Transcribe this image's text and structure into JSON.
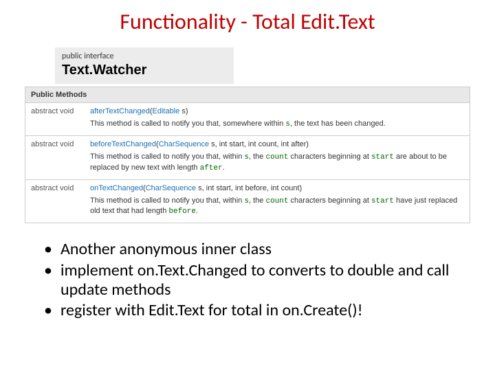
{
  "title": "Functionality - Total Edit.Text",
  "intf": {
    "label": "public interface",
    "name": "Text.Watcher"
  },
  "methods": {
    "header": "Public Methods",
    "rows": [
      {
        "ret": "abstract void",
        "name": "afterTextChanged",
        "params_open": "(",
        "ptype1": "Editable",
        "pargs1": " s)",
        "desc_pre": "This method is called to notify you that, somewhere within ",
        "code1": "s",
        "desc_post": ", the text has been changed."
      },
      {
        "ret": "abstract void",
        "name": "beforeTextChanged",
        "params_open": "(",
        "ptype1": "CharSequence",
        "pargs1": " s, int start, int count, int after)",
        "desc_pre": "This method is called to notify you that, within ",
        "code1": "s",
        "desc_mid1": ", the ",
        "code2": "count",
        "desc_mid2": " characters beginning at ",
        "code3": "start",
        "desc_mid3": " are about to be replaced by new text with length ",
        "code4": "after",
        "desc_post": "."
      },
      {
        "ret": "abstract void",
        "name": "onTextChanged",
        "params_open": "(",
        "ptype1": "CharSequence",
        "pargs1": " s, int start, int before, int count)",
        "desc_pre": "This method is called to notify you that, within ",
        "code1": "s",
        "desc_mid1": ", the ",
        "code2": "count",
        "desc_mid2": " characters beginning at ",
        "code3": "start",
        "desc_mid3": " have just replaced old text that had length ",
        "code4": "before",
        "desc_post": "."
      }
    ]
  },
  "bullets": [
    "Another anonymous inner class",
    "implement on.Text.Changed to converts to double and call update methods",
    "register with Edit.Text for total in on.Create()!"
  ]
}
